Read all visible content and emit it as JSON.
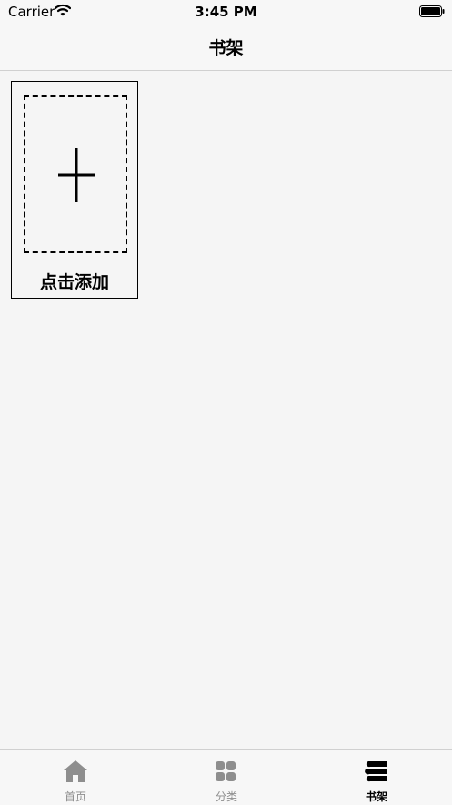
{
  "status": {
    "carrier": "Carrier",
    "time": "3:45 PM",
    "icons": [
      "wifi-icon",
      "battery-icon"
    ]
  },
  "nav": {
    "title": "书架"
  },
  "shelf": {
    "add_label": "点击添加",
    "add_icon": "plus-icon"
  },
  "tabs": [
    {
      "label": "首页",
      "icon": "home-icon",
      "active": false
    },
    {
      "label": "分类",
      "icon": "grid-icon",
      "active": false
    },
    {
      "label": "书架",
      "icon": "bookshelf-icon",
      "active": true
    }
  ],
  "colors": {
    "active": "#000000",
    "inactive": "#8e8e8e",
    "background": "#f5f5f5"
  }
}
